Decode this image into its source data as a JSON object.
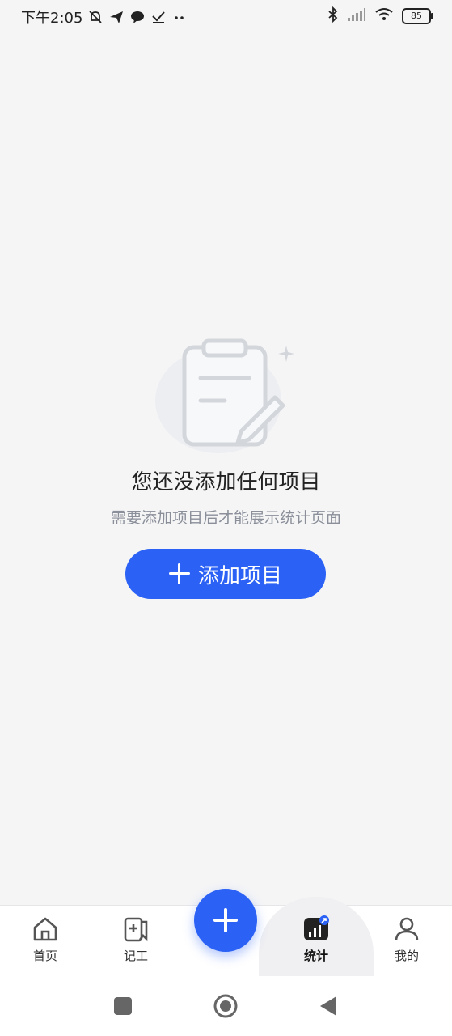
{
  "status_bar": {
    "time": "下午2:05",
    "battery": "85",
    "icons": [
      "mute-bell-icon",
      "send-icon",
      "chat-bubble-icon",
      "check-icon",
      "more-dots-icon",
      "bluetooth-icon",
      "signal-icon",
      "wifi-icon",
      "battery-icon"
    ]
  },
  "empty_state": {
    "title": "您还没添加任何项目",
    "subtitle": "需要添加项目后才能展示统计页面",
    "add_button_label": "添加项目",
    "illustration_icon": "clipboard-edit-icon"
  },
  "tab_bar": {
    "tabs": [
      {
        "label": "首页",
        "icon": "home-icon"
      },
      {
        "label": "记工",
        "icon": "record-work-icon"
      },
      {
        "label": "统计",
        "icon": "statistics-icon",
        "active": true
      },
      {
        "label": "我的",
        "icon": "profile-icon"
      }
    ],
    "fab_icon": "plus-icon"
  },
  "system_nav": {
    "buttons": [
      "recent-apps-icon",
      "home-circle-icon",
      "back-icon"
    ]
  },
  "colors": {
    "accent": "#2b62f5",
    "background": "#f5f5f6",
    "subtitle": "#8a8f99"
  }
}
